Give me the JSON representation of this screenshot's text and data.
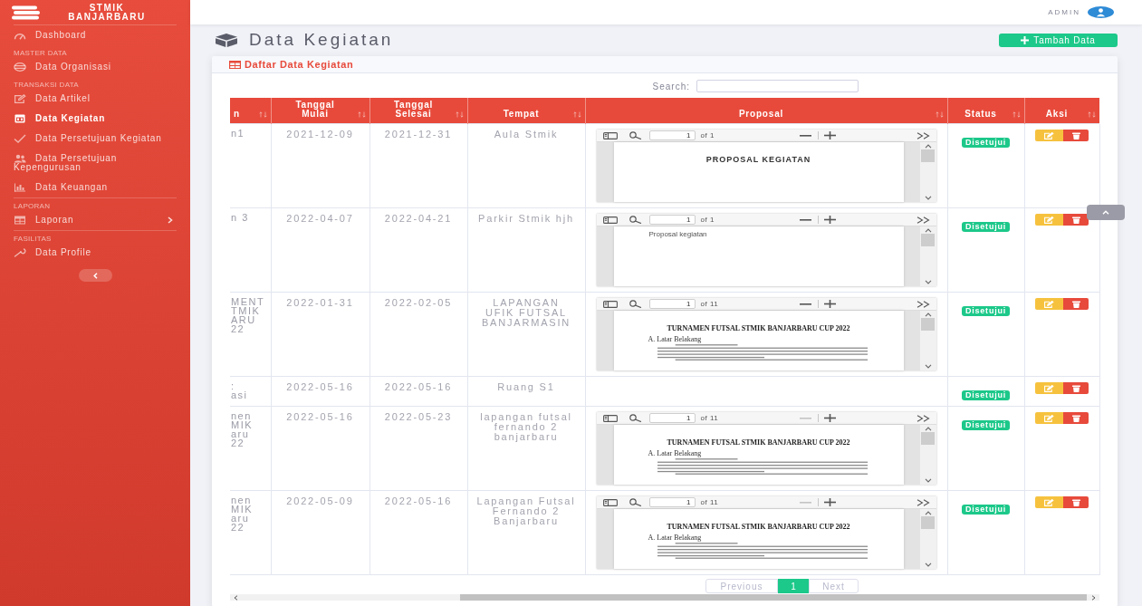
{
  "sidebar": {
    "brand": "STMIK BANJARBARU",
    "sections": [
      {
        "items": [
          {
            "label": "Dashboard",
            "selected": false
          }
        ]
      },
      {
        "heading": "MASTER DATA",
        "items": [
          {
            "label": "Data Organisasi",
            "selected": false
          }
        ]
      },
      {
        "heading": "TRANSAKSI DATA",
        "items": [
          {
            "label": "Data Artikel",
            "selected": false
          },
          {
            "label": "Data Kegiatan",
            "selected": true
          },
          {
            "label": "Data Persetujuan Kegiatan",
            "selected": false
          },
          {
            "label": "Data Persetujuan Kepengurusan",
            "selected": false
          },
          {
            "label": "Data Keuangan",
            "selected": false
          }
        ]
      },
      {
        "heading": "LAPORAN",
        "divider": true,
        "items": [
          {
            "label": "Laporan",
            "selected": false,
            "expanded": false
          }
        ]
      },
      {
        "heading": "FASILITAS",
        "divider": true,
        "items": [
          {
            "label": "Data Profile",
            "selected": false
          }
        ]
      }
    ]
  },
  "topbar": {
    "user": "ADMIN"
  },
  "page": {
    "title": "Data Kegiatan",
    "add_button": "Tambah Data"
  },
  "card": {
    "title": "Daftar Data Kegiatan",
    "search": {
      "label": "Search:"
    },
    "table": {
      "columns": [
        "n",
        "Tanggal Mulai",
        "Tanggal Selesai",
        "Tempat",
        "Proposal",
        "Status",
        "Aksi"
      ],
      "rows": [
        {
          "column_1": [
            "n1"
          ],
          "tanggal_mulai": "2021-12-09",
          "tanggal_selesai": "2021-12-31",
          "tempat": "Aula Stmik",
          "proposal": {
            "page": "1",
            "page_count": "of 1",
            "zoom_out_disabled": false,
            "document": {
              "kind": "title",
              "heading": "PROPOSAL KEGIATAN"
            }
          },
          "status": "Disetujui"
        },
        {
          "column_1": [
            "n 3"
          ],
          "tanggal_mulai": "2022-04-07",
          "tanggal_selesai": "2022-04-21",
          "tempat": "Parkir Stmik hjh",
          "proposal": {
            "page": "1",
            "page_count": "of 1",
            "zoom_out_disabled": false,
            "document": {
              "kind": "note",
              "text": "Proposal kegiatan"
            }
          },
          "status": "Disetujui"
        },
        {
          "column_1": [
            "MENT",
            "TMIK",
            "ARU",
            "22"
          ],
          "tanggal_mulai": "2022-01-31",
          "tanggal_selesai": "2022-02-05",
          "tempat": "LAPANGAN UFIK FUTSAL BANJARMASIN",
          "proposal": {
            "page": "1",
            "page_count": "of 11",
            "zoom_out_disabled": false,
            "document": {
              "kind": "report",
              "heading": "TURNAMEN FUTSAL STMIK BANJARBARU CUP 2022",
              "section": "A. Latar Belakang"
            }
          },
          "status": "Disetujui"
        },
        {
          "column_1": [
            ":",
            "asi"
          ],
          "tanggal_mulai": "2022-05-16",
          "tanggal_selesai": "2022-05-16",
          "tempat": "Ruang S1",
          "status": "Disetujui"
        },
        {
          "column_1": [
            "nen",
            "MIK",
            "aru",
            "22"
          ],
          "tanggal_mulai": "2022-05-16",
          "tanggal_selesai": "2022-05-23",
          "tempat": "lapangan futsal fernando 2 banjarbaru",
          "proposal": {
            "page": "1",
            "page_count": "of 11",
            "zoom_out_disabled": true,
            "document": {
              "kind": "report",
              "heading": "TURNAMEN FUTSAL STMIK BANJARBARU CUP 2022",
              "section": "A. Latar Belakang"
            }
          },
          "status": "Disetujui"
        },
        {
          "column_1": [
            "nen",
            "MIK",
            "aru",
            "22"
          ],
          "tanggal_mulai": "2022-05-09",
          "tanggal_selesai": "2022-05-16",
          "tempat": "Lapangan Futsal Fernando 2 Banjarbaru",
          "proposal": {
            "page": "1",
            "page_count": "of 11",
            "zoom_out_disabled": true,
            "document": {
              "kind": "report",
              "heading": "TURNAMEN FUTSAL STMIK BANJARBARU CUP 2022",
              "section": "A. Latar Belakang"
            }
          },
          "status": "Disetujui"
        }
      ]
    },
    "pagination": {
      "previous": {
        "label": "Previous",
        "disabled": true
      },
      "pages": [
        {
          "label": "1",
          "selected": true
        }
      ],
      "next": {
        "label": "Next",
        "disabled": true
      }
    }
  }
}
